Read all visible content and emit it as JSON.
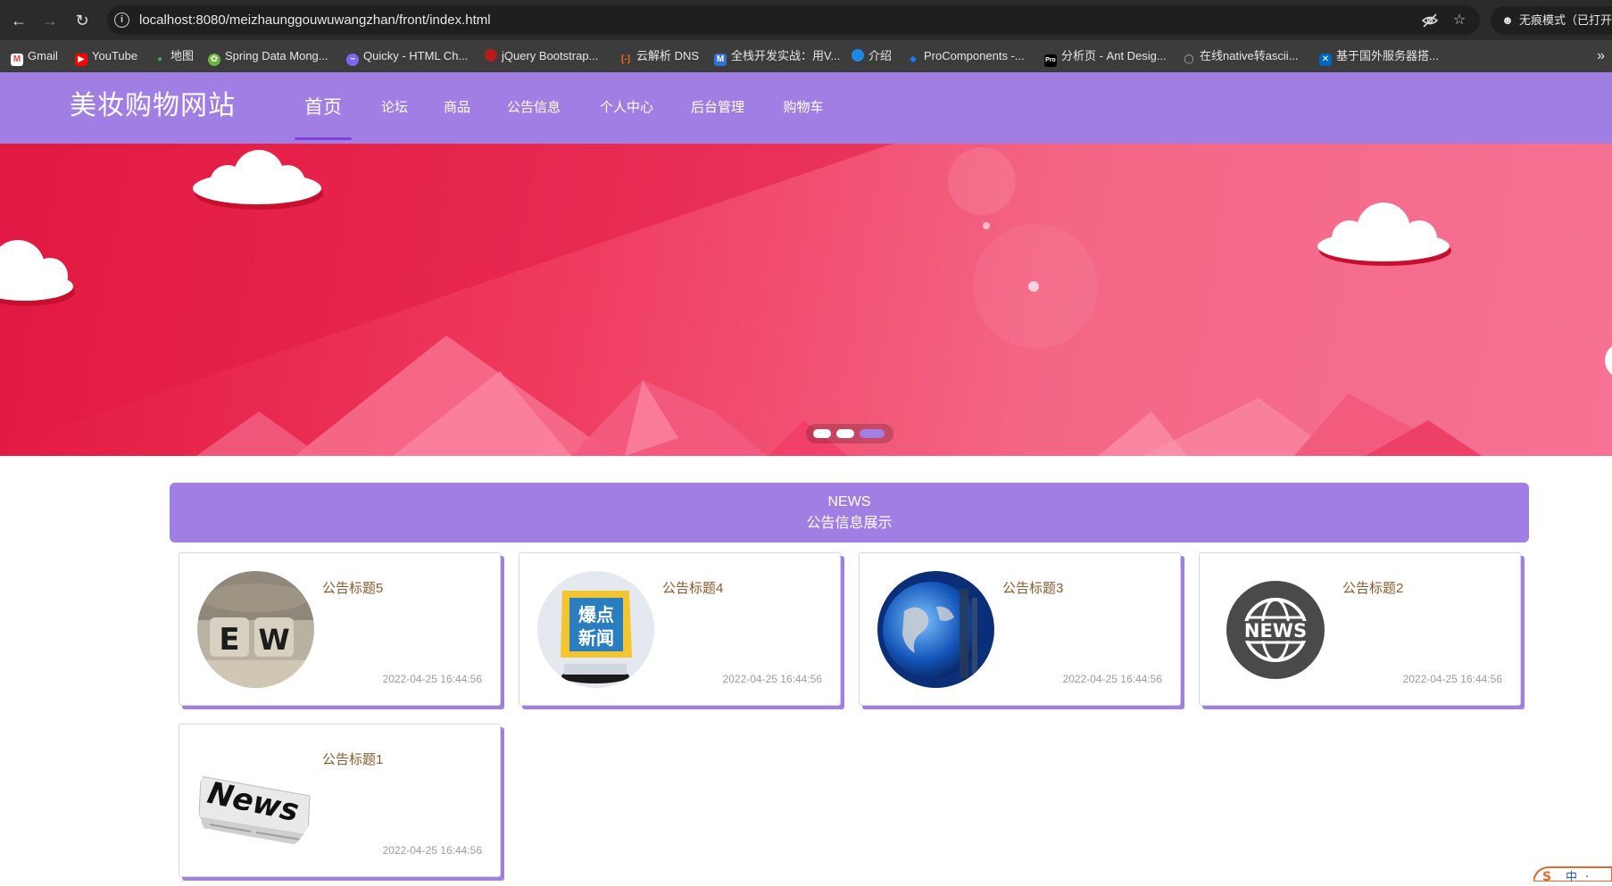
{
  "browser": {
    "url": "localhost:8080/meizhaunggouwuwangzhan/front/index.html",
    "incognito_label": "无痕模式（已打开",
    "bookmarks": [
      {
        "label": "Gmail",
        "icon": "gmail-icon",
        "color": "#ea4335"
      },
      {
        "label": "YouTube",
        "icon": "youtube-icon",
        "color": "#ff0000"
      },
      {
        "label": "地图",
        "icon": "maps-pin-icon",
        "color": "#34a853"
      },
      {
        "label": "Spring Data Mong...",
        "icon": "spring-leaf-icon",
        "color": "#6db33f"
      },
      {
        "label": "Quicky - HTML Ch...",
        "icon": "messenger-icon",
        "color": "#7b68ee"
      },
      {
        "label": "jQuery Bootstrap...",
        "icon": "jquery-icon",
        "color": "#b71c1c"
      },
      {
        "label": "云解析 DNS",
        "icon": "aliyun-icon",
        "color": "#ff6a00"
      },
      {
        "label": "全栈开发实战：用V...",
        "icon": "m-logo-icon",
        "color": "#2f6fd6"
      },
      {
        "label": "介绍",
        "icon": "circle-logo-icon",
        "color": "#1e88e5"
      },
      {
        "label": "ProComponents -...",
        "icon": "ant-diamond-icon",
        "color": "#1677ff"
      },
      {
        "label": "分析页 - Ant Desig...",
        "icon": "pro-icon",
        "color": "#000000"
      },
      {
        "label": "在线native转ascii...",
        "icon": "globe-icon",
        "color": "#9e9e9e"
      },
      {
        "label": "基于国外服务器搭...",
        "icon": "scotland-flag-icon",
        "color": "#0065bd"
      }
    ]
  },
  "site": {
    "logo": "美妆购物网站",
    "nav": [
      {
        "label": "首页",
        "active": true
      },
      {
        "label": "论坛",
        "active": false
      },
      {
        "label": "商品",
        "active": false
      },
      {
        "label": "公告信息",
        "active": false
      },
      {
        "label": "个人中心",
        "active": false
      },
      {
        "label": "后台管理",
        "active": false
      },
      {
        "label": "购物车",
        "active": false
      }
    ],
    "accent_color": "#a07ee3"
  },
  "banner": {
    "slide_count": 3,
    "active_slide": 3
  },
  "news": {
    "heading_en": "NEWS",
    "heading_cn": "公告信息展示",
    "items": [
      {
        "title": "公告标题5",
        "time": "2022-04-25 16:44:56",
        "image": "ew-blocks-image"
      },
      {
        "title": "公告标题4",
        "time": "2022-04-25 16:44:56",
        "image": "baodian-xinwen-image"
      },
      {
        "title": "公告标题3",
        "time": "2022-04-25 16:44:56",
        "image": "globe-news-image"
      },
      {
        "title": "公告标题2",
        "time": "2022-04-25 16:44:56",
        "image": "news-globe-badge-image"
      },
      {
        "title": "公告标题1",
        "time": "2022-04-25 16:44:56",
        "image": "newspaper-image"
      }
    ]
  }
}
